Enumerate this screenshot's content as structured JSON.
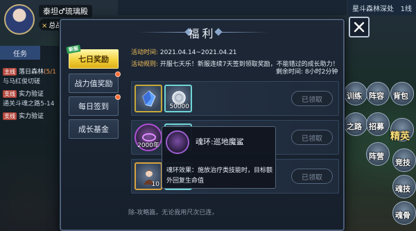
{
  "player": {
    "name": "泰坦♂琉璃殿",
    "power_prefix": "×",
    "power_label": "总战"
  },
  "map": {
    "name": "星斗森林深处",
    "line": "1线"
  },
  "tasks": {
    "title": "任务",
    "items": [
      {
        "tag": "主线",
        "name": "落日森林",
        "progress": "(5/1",
        "sub": "与马红俊切磋"
      },
      {
        "tag": "支线",
        "name": "实力验证",
        "progress": "",
        "sub": "通关斗魂之路5-14"
      },
      {
        "tag": "支线",
        "name": "实力验证",
        "progress": "",
        "sub": ""
      }
    ]
  },
  "modal": {
    "title": "福利",
    "tabs": [
      {
        "label": "七日奖励",
        "active": true,
        "badge": "新服",
        "dot": false
      },
      {
        "label": "战力值奖励",
        "active": false,
        "badge": "",
        "dot": true
      },
      {
        "label": "每日签到",
        "active": false,
        "badge": "",
        "dot": true
      },
      {
        "label": "成长基金",
        "active": false,
        "badge": "",
        "dot": false
      }
    ],
    "event_time_label": "活动时间:",
    "event_time_value": "2021.04.14~2021.04.21",
    "event_rule_label": "活动规则:",
    "event_rule_value": "开服七天乐！新服连续7天签到领取奖励，不能错过的成长助力！",
    "remaining_label": "剩余时间:",
    "remaining_value": "8小时2分钟",
    "rewards": [
      {
        "items": [
          {
            "icon": "crystal-icon",
            "qty": ""
          },
          {
            "icon": "coin-icon",
            "qty": "50000"
          }
        ],
        "claim": "已领取"
      },
      {
        "items": [
          {
            "icon": "spirit-ring-icon",
            "qty": "2000年"
          },
          {
            "icon": "shark-icon",
            "qty": ""
          }
        ],
        "claim": "已领取"
      },
      {
        "items": [
          {
            "icon": "character-icon",
            "qty": "10"
          },
          {
            "icon": "item-icon",
            "qty": ""
          }
        ],
        "claim": "已领取"
      }
    ],
    "bottom_text": "除-攻略篇，无论我用尺次已连，"
  },
  "tooltip": {
    "name": "魂环:巡地魔鲨",
    "desc": "魂环效果：施放治疗类技能时，目标额外回复生命值"
  },
  "side": {
    "labels": [
      "训练",
      "阵容",
      "背包",
      "之路",
      "招募",
      "精英",
      "阵营",
      "竞技",
      "魂技",
      "魂骨"
    ]
  },
  "colors": {
    "accent": "#f3d23c",
    "label_orange": "#f2c05c",
    "panel": "#1d2736"
  }
}
